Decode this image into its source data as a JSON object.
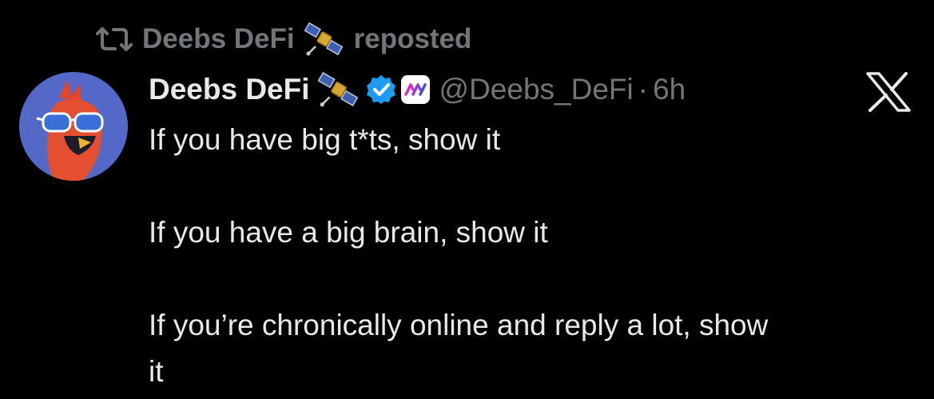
{
  "repost": {
    "icon": "repost-icon",
    "name": "Deebs DeFi",
    "emoji": "satellite-emoji-icon",
    "label": "reposted"
  },
  "tweet": {
    "author": {
      "display_name": "Deebs DeFi",
      "emoji": "satellite-emoji-icon",
      "verified_icon": "verified-badge-icon",
      "affiliate_icon": "affiliate-logo-icon",
      "handle": "@Deebs_DeFi",
      "separator": "·",
      "time": "6h"
    },
    "lines": [
      "If you have big t*ts, show it",
      "If you have a big brain, show it",
      "If you’re chronically online and reply a lot, show",
      "it"
    ]
  },
  "brand": {
    "icon": "x-logo-icon"
  },
  "colors": {
    "background": "#000000",
    "text": "#e7e9ea",
    "secondary": "#71767b",
    "verified": "#1d9bf0",
    "affiliate_accent": "#d52ec6"
  }
}
